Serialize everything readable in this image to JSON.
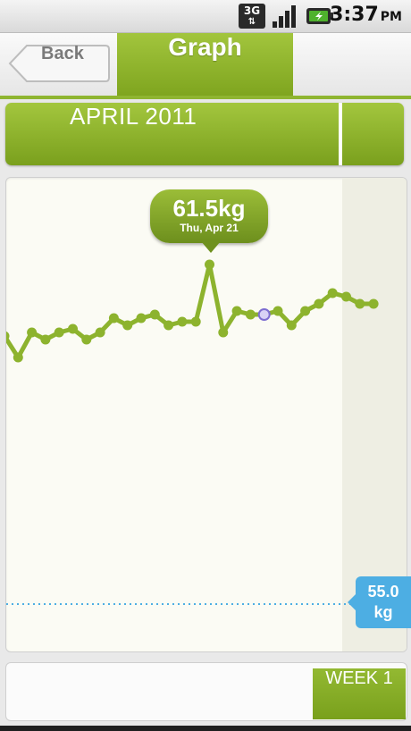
{
  "status_bar": {
    "network": "3G",
    "time": "3:37",
    "ampm": "PM",
    "icons": [
      "network-3g-icon",
      "signal-icon",
      "battery-charging-icon"
    ],
    "battery_color": "#4fb22d"
  },
  "header": {
    "back_label": "Back",
    "title_tab": "Graph",
    "accent_color": "#8fb531"
  },
  "month_bar": {
    "label": "APRIL 2011"
  },
  "chart_data": {
    "type": "line",
    "x_unit": "day of April 2011",
    "y_unit": "kg",
    "x": [
      2,
      3,
      4,
      5,
      6,
      7,
      8,
      9,
      10,
      11,
      12,
      13,
      14,
      15,
      16,
      17,
      18,
      19,
      20,
      21,
      22,
      23,
      24,
      25,
      26,
      27,
      28,
      29,
      30,
      31
    ],
    "values": [
      63.5,
      64.1,
      63.4,
      63.6,
      63.4,
      63.3,
      63.6,
      63.4,
      63.0,
      63.2,
      63.0,
      62.9,
      63.2,
      63.1,
      63.1,
      61.5,
      63.4,
      62.8,
      62.9,
      62.9,
      62.8,
      63.2,
      62.8,
      62.6,
      62.3,
      62.4,
      62.6,
      62.6,
      null,
      null
    ],
    "selected": {
      "value_text": "61.5kg",
      "date_text": "Thu, Apr 21",
      "day": 21
    },
    "goal": {
      "value": 55.0,
      "label_value": "55.0",
      "label_unit": "kg"
    },
    "ylim": [
      54,
      66
    ],
    "grid": false,
    "line_color": "#8db32e",
    "goal_color": "#4daee3"
  },
  "bottom_bar": {
    "week_label": "WEEK 1"
  }
}
